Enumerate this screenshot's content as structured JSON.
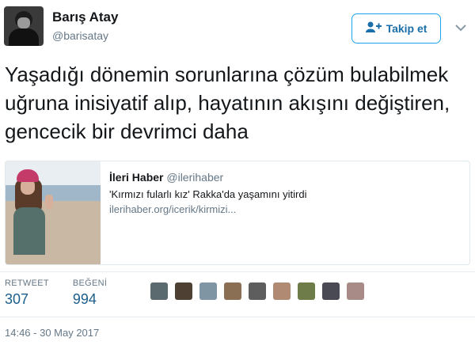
{
  "author": {
    "name": "Barış Atay",
    "handle": "@barisatay"
  },
  "follow_button": {
    "label": "Takip et",
    "icon": "add-user-icon"
  },
  "menu_icon": "chevron-down-icon",
  "tweet": {
    "text": "Yaşadığı dönemin sorunlarına çözüm bulabilmek uğruna inisiyatif alıp, hayatının akışını değiştiren, gencecik bir devrimci daha"
  },
  "card": {
    "source_name": "İleri Haber",
    "source_handle": "@ilerihaber",
    "title": "'Kırmızı fularlı kız' Rakka'da yaşamını yitirdi",
    "url": "ilerihaber.org/icerik/kirmizi..."
  },
  "stats": {
    "retweet_label": "RETWEET",
    "retweet_count": "307",
    "like_label": "BEĞENİ",
    "like_count": "994"
  },
  "likers": [
    {
      "color": "#5b6a6e"
    },
    {
      "color": "#4e4033"
    },
    {
      "color": "#7f95a3"
    },
    {
      "color": "#8a6f55"
    },
    {
      "color": "#5e5e5e"
    },
    {
      "color": "#b08a72"
    },
    {
      "color": "#6e7c4a"
    },
    {
      "color": "#4a4a55"
    },
    {
      "color": "#a88a86"
    }
  ],
  "timestamp": "14:46 - 30 May 2017"
}
